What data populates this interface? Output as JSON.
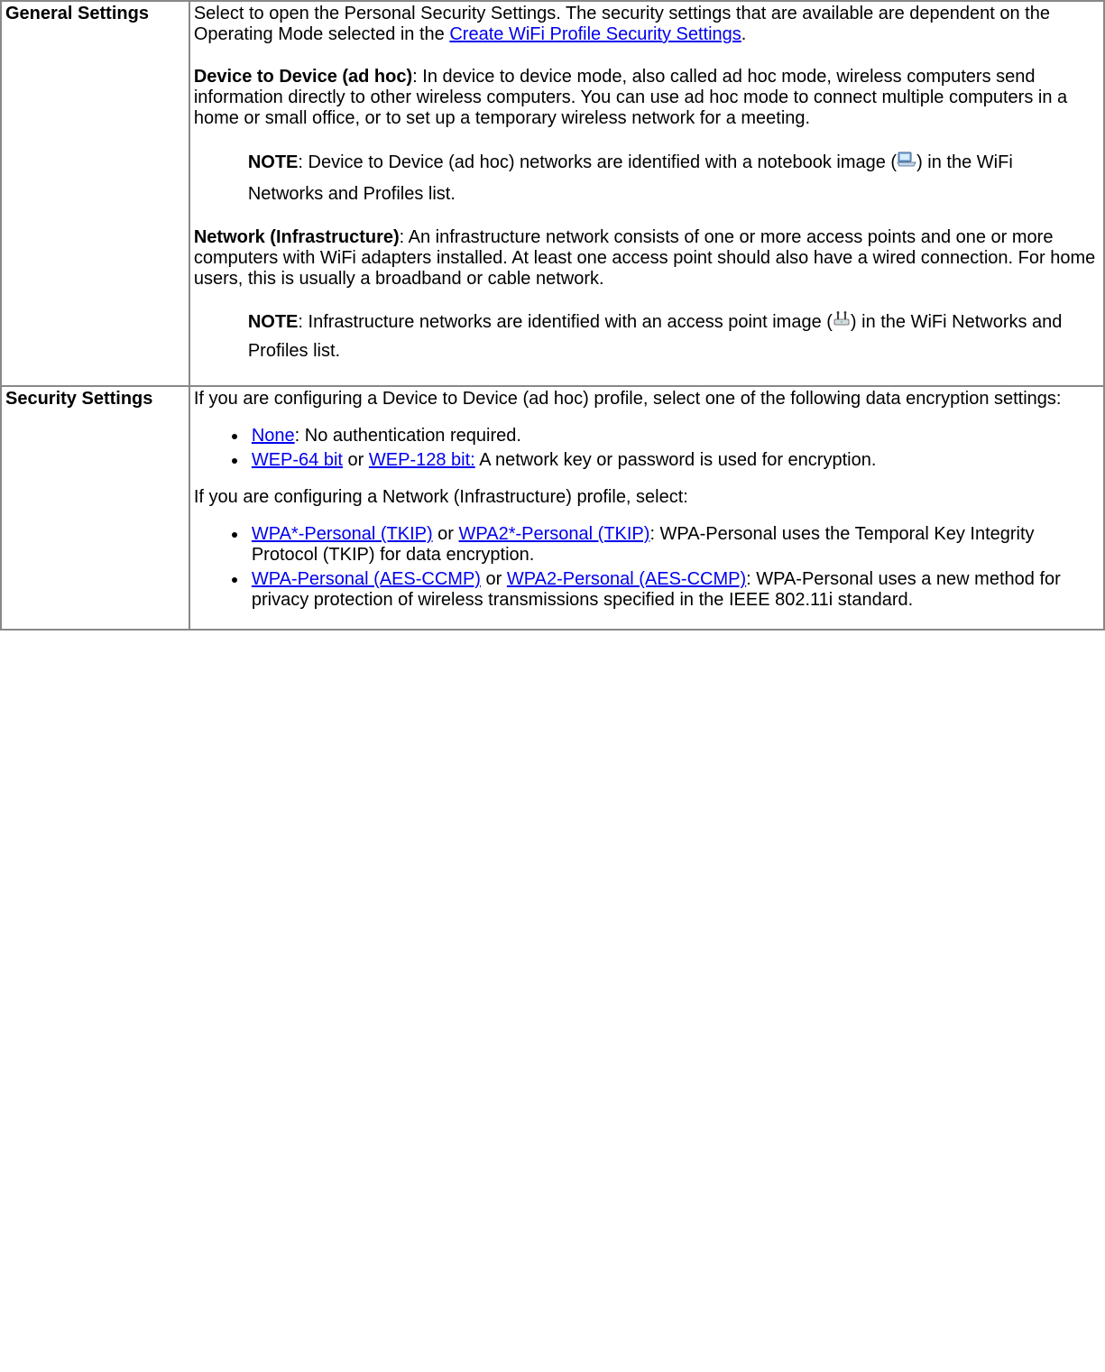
{
  "row1": {
    "label": "General Settings",
    "intro_pre": "Select to open the Personal Security Settings. The security settings that are available are dependent on the Operating Mode selected in the ",
    "intro_link": "Create WiFi Profile Security Settings",
    "intro_post": ".",
    "adhoc_label": "Device to Device (ad hoc)",
    "adhoc_text": ": In device to device mode, also called ad hoc mode, wireless computers send information directly to other wireless computers. You can use ad hoc mode to connect multiple computers in a home or small office, or to set up a temporary wireless network for a meeting.",
    "note_label": "NOTE",
    "adhoc_note_pre": ": Device to Device (ad hoc) networks are identified with a notebook image (",
    "adhoc_note_post": ") in the WiFi Networks and Profiles list.",
    "infra_label": "Network (Infrastructure)",
    "infra_text": ": An infrastructure network consists of one or more access points and one or more computers with WiFi adapters installed. At least one access point should also have a wired connection. For home users, this is usually a broadband or cable network.",
    "infra_note_pre": ": Infrastructure networks are identified with an access point image (",
    "infra_note_post": ") in the WiFi Networks and Profiles list."
  },
  "row2": {
    "label": "Security Settings",
    "adhoc_intro": "If you are configuring a Device to Device (ad hoc) profile, select one of the following data encryption settings:",
    "li1_link": "None",
    "li1_text": ": No authentication required.",
    "li2_link1": "WEP-64 bit",
    "li2_or": " or ",
    "li2_link2": "WEP-128 bit:",
    "li2_text": " A network key or password is used for encryption.",
    "infra_intro": "If you are configuring a Network (Infrastructure) profile, select:",
    "li3_link1": "WPA*-Personal (TKIP)",
    "li3_or": " or ",
    "li3_link2": "WPA2*-Personal (TKIP)",
    "li3_text": ": WPA-Personal uses the Temporal Key Integrity Protocol (TKIP) for data encryption.",
    "li4_link1": "WPA-Personal (AES-CCMP)",
    "li4_or": " or ",
    "li4_link2": "WPA2-Personal (AES-CCMP)",
    "li4_text": ": WPA-Personal uses a new method for privacy protection of wireless transmissions specified in the IEEE 802.11i standard."
  }
}
